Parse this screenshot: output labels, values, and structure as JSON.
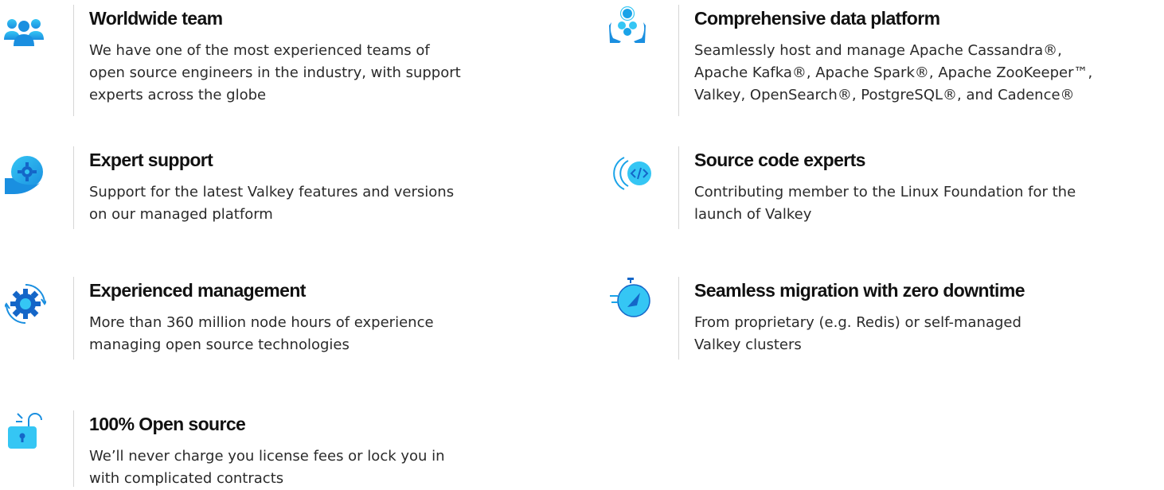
{
  "colors": {
    "accent": "#1aa3e8",
    "accent_light": "#35c6f4",
    "title_text": "#111111",
    "body_text": "#2a2a2a",
    "divider": "#d6d6d6"
  },
  "features": [
    {
      "icon": "team-icon",
      "title": "Worldwide team",
      "lines": [
        "We have one of the most experienced teams of",
        "open source engineers in the industry, with support",
        "experts across the globe"
      ]
    },
    {
      "icon": "data-platform-icon",
      "title": "Comprehensive data platform",
      "lines": [
        "Seamlessly host and manage Apache Cassandra®,",
        "Apache Kafka®, Apache Spark®, Apache ZooKeeper™,",
        "Valkey, OpenSearch®, PostgreSQL®, and Cadence®"
      ]
    },
    {
      "icon": "support-gear-icon",
      "title": "Expert support",
      "lines": [
        "Support for the latest Valkey features and versions",
        "on our managed platform"
      ]
    },
    {
      "icon": "source-code-icon",
      "title": "Source code experts",
      "lines": [
        "Contributing member to the Linux Foundation for the",
        "launch of Valkey"
      ]
    },
    {
      "icon": "gear-cycle-icon",
      "title": "Experienced management",
      "lines": [
        "More than 360 million node hours of experience",
        "managing open source technologies"
      ]
    },
    {
      "icon": "stopwatch-icon",
      "title": "Seamless migration with zero downtime",
      "lines": [
        "From proprietary (e.g. Redis) or self-managed",
        "Valkey clusters"
      ]
    },
    {
      "icon": "open-lock-icon",
      "title": "100% Open source",
      "lines": [
        "We’ll never charge you license fees or lock you in",
        "with complicated contracts"
      ]
    }
  ]
}
